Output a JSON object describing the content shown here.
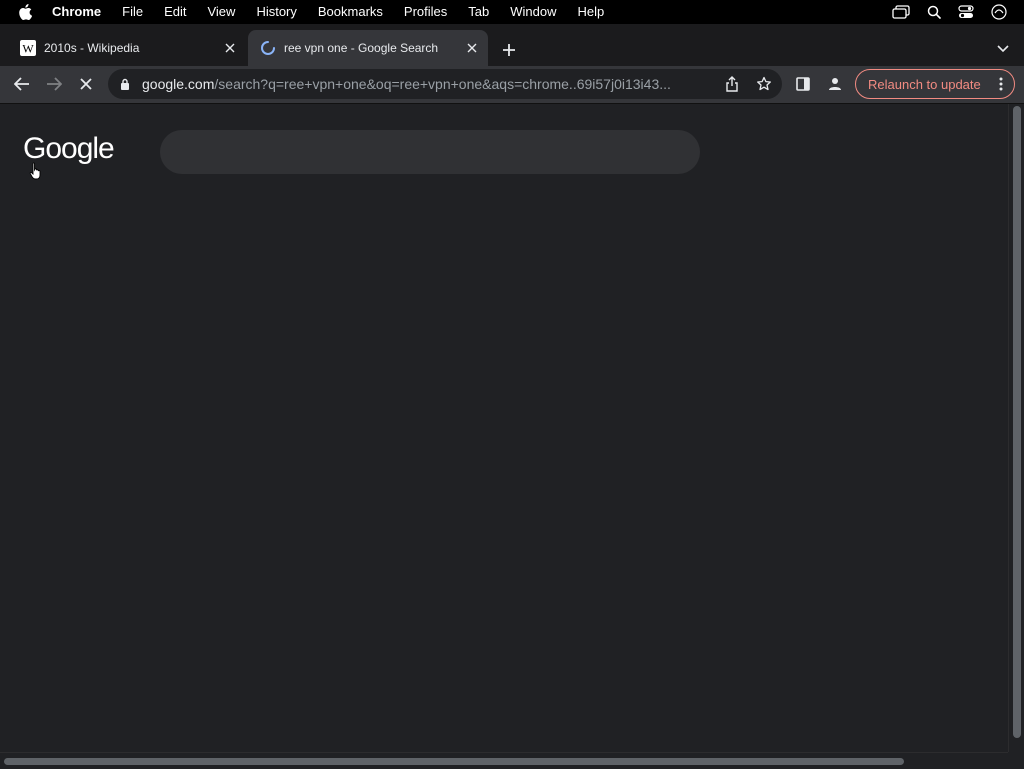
{
  "menubar": {
    "apple_icon": "apple-logo-icon",
    "items": [
      "Chrome",
      "File",
      "Edit",
      "View",
      "History",
      "Bookmarks",
      "Profiles",
      "Tab",
      "Window",
      "Help"
    ],
    "status_icons": [
      "screen-mirroring-icon",
      "spotlight-search-icon",
      "control-center-icon",
      "siri-icon"
    ]
  },
  "tabs": [
    {
      "title": "2010s - Wikipedia",
      "favicon": "wikipedia-w-icon",
      "active": false
    },
    {
      "title": "ree vpn one - Google Search",
      "favicon": "loading-spinner-icon",
      "active": true
    }
  ],
  "toolbar": {
    "url_host": "google.com",
    "url_rest": "/search?q=ree+vpn+one&oq=ree+vpn+one&aqs=chrome..69i57j0i13i43...",
    "relaunch_label": "Relaunch to update"
  },
  "page": {
    "logo_text": "Google",
    "search_value": ""
  },
  "colors": {
    "page_bg": "#202124",
    "toolbar_bg": "#35363a",
    "relaunch_accent": "#f28b82"
  }
}
